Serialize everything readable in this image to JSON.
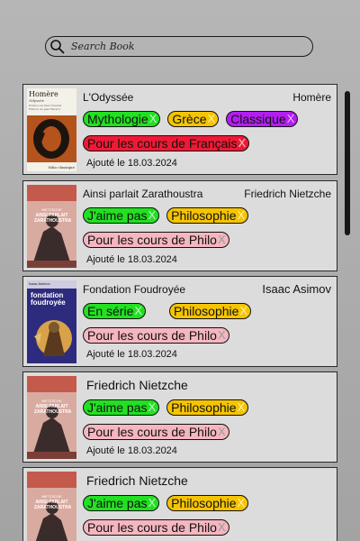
{
  "search": {
    "placeholder": "Search Book",
    "icon": "search-icon"
  },
  "colors": {
    "green": "#22e022",
    "yellow": "#f5c400",
    "purple": "#b21ef0",
    "red": "#ee1a35",
    "pink": "#f5b6c0",
    "x_green": "#c9f5c9",
    "x_yellow": "#fff3b0",
    "x_purple": "#ecb8ff",
    "x_red": "#ffc4cc",
    "x_pink": "#9a9a9a"
  },
  "books": [
    {
      "title": "L'Odyssée",
      "author": "Homère",
      "cover": {
        "author": "Homère",
        "title": "Odyssée",
        "line1": "Préface de Paul Claudel",
        "line2": "Édition de Jean Bérard",
        "publisher": "folio classique"
      },
      "tags": [
        {
          "label": "Mythologie",
          "x": "X",
          "color": "green"
        },
        {
          "label": "Grèce",
          "x": "X",
          "color": "yellow"
        },
        {
          "label": "Classique",
          "x": "X",
          "color": "purple"
        },
        {
          "label": "Pour les cours de Français",
          "x": "X",
          "color": "red"
        }
      ],
      "added": "Ajouté le 18.03.2024"
    },
    {
      "title": "Ainsi parlait Zarathoustra",
      "author": "Friedrich Nietzche",
      "cover": {
        "author": "NIETZSCHE",
        "title": "AINSI PARLAIT ZARATHOUSTRA"
      },
      "tags": [
        {
          "label": "J'aime pas",
          "x": "X",
          "color": "green"
        },
        {
          "label": "Philosophie",
          "x": "X",
          "color": "yellow"
        },
        {
          "label": "Pour les cours de Philo",
          "x": "X",
          "color": "pink"
        }
      ],
      "added": "Ajouté le 18.03.2024"
    },
    {
      "title": "Fondation Foudroyée",
      "author": "Isaac Asimov",
      "cover": {
        "author": "Isaac Asimov",
        "title": "fondation foudroyée"
      },
      "tags": [
        {
          "label": "En série",
          "x": "X",
          "color": "green"
        },
        {
          "label": "Philosophie",
          "x": "X",
          "color": "yellow"
        },
        {
          "label": "Pour les cours de Philo",
          "x": "X",
          "color": "pink"
        }
      ],
      "added": "Ajouté le 18.03.2024"
    },
    {
      "title": "",
      "author": "Friedrich Nietzche",
      "cover": {
        "author": "NIETZSCHE",
        "title": "AINSI PARLAIT ZARATHOUSTRA"
      },
      "tags": [
        {
          "label": "J'aime pas",
          "x": "X",
          "color": "green"
        },
        {
          "label": "Philosophie",
          "x": "X",
          "color": "yellow"
        },
        {
          "label": "Pour les cours de Philo",
          "x": "X",
          "color": "pink"
        }
      ],
      "added": "Ajouté le 18.03.2024"
    },
    {
      "title": "",
      "author": "Friedrich Nietzche",
      "cover": {
        "author": "NIETZSCHE",
        "title": "AINSI PARLAIT ZARATHOUSTRA"
      },
      "tags": [
        {
          "label": "J'aime pas",
          "x": "X",
          "color": "green"
        },
        {
          "label": "Philosophie",
          "x": "X",
          "color": "yellow"
        },
        {
          "label": "Pour les cours de Philo",
          "x": "X",
          "color": "pink"
        }
      ],
      "added": ""
    }
  ]
}
